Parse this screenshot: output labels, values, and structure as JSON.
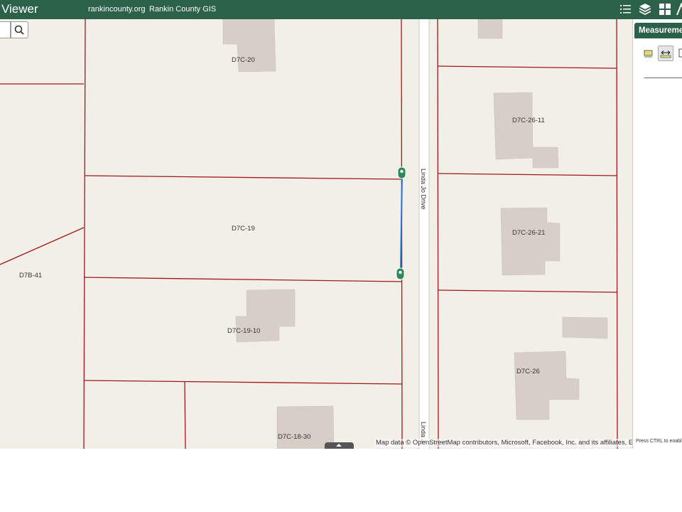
{
  "header": {
    "title": "Viewer",
    "links": [
      "rankincounty.org",
      "Rankin County GIS"
    ]
  },
  "toolbar": {
    "icons": [
      "legend-list-icon",
      "layers-icon",
      "basemap-gallery-icon",
      "measurement-icon"
    ]
  },
  "map": {
    "parcel_labels": [
      "D7C-20",
      "D7C-19",
      "D7B-41",
      "D7C-19-10",
      "D7C-18-30",
      "D7C-26-11",
      "D7C-26-21",
      "D7C-26"
    ],
    "road_labels": [
      "Linda Jo Drive",
      "Linda J"
    ],
    "attribution": "Map data © OpenStreetMap contributors, Microsoft, Facebook, Inc. and its affiliates, Esri Commu",
    "colors": {
      "background": "#f2efe9",
      "parcel_line": "#a01818",
      "building": "#d7cfc7",
      "measure_line": "#2a6fd6",
      "marker": "#2a8a5a"
    }
  },
  "panel": {
    "title": "Measurement",
    "hint": "Press CTRL to enable snapping",
    "tools": [
      "area-tool-icon",
      "distance-tool-icon",
      "location-tool-icon"
    ]
  },
  "theme": {
    "header_bg": "#2b6148"
  }
}
